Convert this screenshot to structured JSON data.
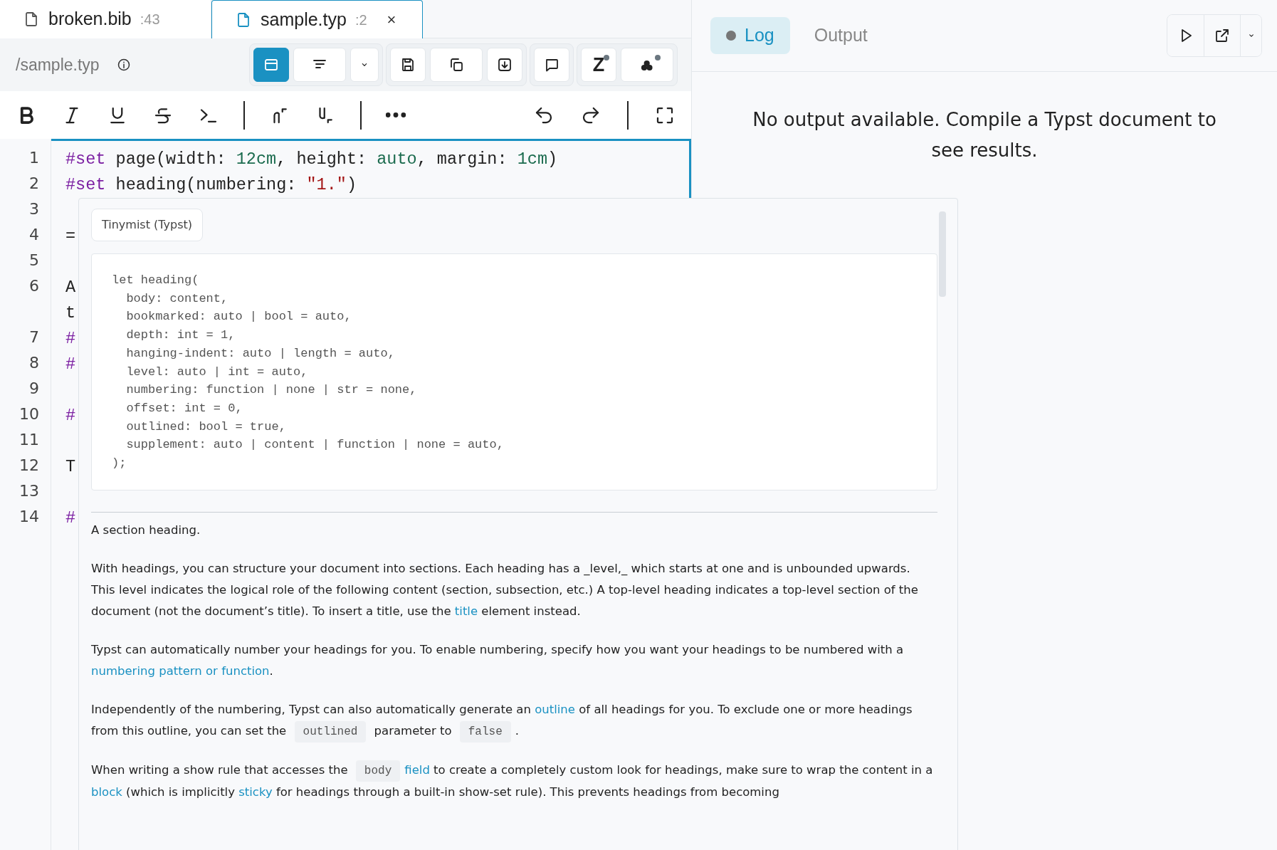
{
  "file_tabs": [
    {
      "label": "broken.bib",
      "badge": ":43",
      "selected": false
    },
    {
      "label": "sample.typ",
      "badge": ":2",
      "selected": true,
      "close": "×"
    }
  ],
  "path": "/sample.typ",
  "toolbar": {
    "groups": [
      [
        {
          "kind": "panel",
          "pressed": true
        },
        {
          "kind": "align",
          "pressed": false
        },
        {
          "kind": "dropdown",
          "pressed": false
        }
      ],
      [
        {
          "kind": "save",
          "pressed": false
        },
        {
          "kind": "copy",
          "pressed": false
        },
        {
          "kind": "download",
          "pressed": false
        }
      ],
      [
        {
          "kind": "comment",
          "pressed": false
        }
      ],
      [
        {
          "kind": "letter",
          "label": "Z",
          "pressed": false
        },
        {
          "kind": "cluster",
          "pressed": false
        }
      ]
    ]
  },
  "format_bar": {
    "left": [
      {
        "kind": "bold"
      },
      {
        "kind": "italic"
      },
      {
        "kind": "underline"
      },
      {
        "kind": "strike"
      },
      {
        "kind": "code"
      },
      {
        "kind": "separator"
      },
      {
        "kind": "superscript"
      },
      {
        "kind": "subscript"
      },
      {
        "kind": "separator"
      },
      {
        "kind": "more"
      }
    ],
    "right": [
      {
        "kind": "undo"
      },
      {
        "kind": "redo"
      },
      {
        "kind": "separator"
      },
      {
        "kind": "fullscreen"
      }
    ]
  },
  "editor": {
    "rows": [
      {
        "number": "1",
        "tokens": [
          {
            "text": "#set",
            "kind": "keyword"
          },
          {
            "text": " page(width: ",
            "kind": "plain"
          },
          {
            "text": "12cm",
            "kind": "value"
          },
          {
            "text": ", height: ",
            "kind": "plain"
          },
          {
            "text": "auto",
            "kind": "value"
          },
          {
            "text": ", margin: ",
            "kind": "plain"
          },
          {
            "text": "1cm",
            "kind": "value"
          },
          {
            "text": ")",
            "kind": "plain"
          }
        ]
      },
      {
        "number": "2",
        "tokens": [
          {
            "text": "#set",
            "kind": "keyword"
          },
          {
            "text": " heading(numbering: ",
            "kind": "plain"
          },
          {
            "text": "\"1.\"",
            "kind": "string"
          },
          {
            "text": ")",
            "kind": "plain"
          }
        ]
      },
      {
        "number": "3",
        "tokens": []
      },
      {
        "number": "4",
        "tokens": [
          {
            "text": "=",
            "kind": "plain"
          }
        ]
      },
      {
        "number": "5",
        "tokens": []
      },
      {
        "number": "6",
        "tokens": [
          {
            "text": "A",
            "kind": "plain"
          }
        ]
      },
      {
        "tokens": [
          {
            "text": "t",
            "kind": "plain"
          }
        ]
      },
      {
        "number": "7",
        "tokens": [
          {
            "text": "#",
            "kind": "keyword"
          }
        ]
      },
      {
        "number": "8",
        "tokens": [
          {
            "text": "#",
            "kind": "keyword"
          }
        ]
      },
      {
        "number": "9",
        "tokens": []
      },
      {
        "number": "10",
        "tokens": [
          {
            "text": "#",
            "kind": "keyword"
          }
        ]
      },
      {
        "number": "11",
        "tokens": []
      },
      {
        "number": "12",
        "tokens": [
          {
            "text": "T",
            "kind": "plain"
          }
        ]
      },
      {
        "number": "13",
        "tokens": []
      },
      {
        "number": "14",
        "tokens": [
          {
            "text": "#",
            "kind": "keyword"
          }
        ]
      }
    ]
  },
  "hover": {
    "source": "Tinymist (Typst)",
    "signature": [
      "let heading(",
      "  body: content,",
      "  bookmarked: auto | bool = auto,",
      "  depth: int = 1,",
      "  hanging-indent: auto | length = auto,",
      "  level: auto | int = auto,",
      "  numbering: function | none | str = none,",
      "  offset: int = 0,",
      "  outlined: bool = true,",
      "  supplement: auto | content | function | none = auto,",
      ");"
    ],
    "paragraphs": [
      [
        {
          "kind": "text",
          "text": "A section heading."
        }
      ],
      [
        {
          "kind": "text",
          "text": "With headings, you can structure your document into sections. Each heading has a _level,_ which starts at one and is unbounded upwards. This level indicates the logical role of the following content (section, subsection, etc.) A top-level heading indicates a top-level section of the document (not the document’s title). To insert a title, use the "
        },
        {
          "kind": "link",
          "text": "title"
        },
        {
          "kind": "text",
          "text": " element instead."
        }
      ],
      [
        {
          "kind": "text",
          "text": "Typst can automatically number your headings for you. To enable numbering, specify how you want your headings to be numbered with a "
        },
        {
          "kind": "link",
          "text": "numbering pattern or function"
        },
        {
          "kind": "text",
          "text": "."
        }
      ],
      [
        {
          "kind": "text",
          "text": "Independently of the numbering, Typst can also automatically generate an "
        },
        {
          "kind": "link",
          "text": "outline"
        },
        {
          "kind": "text",
          "text": " of all headings for you. To exclude one or more headings from this outline, you can set the "
        },
        {
          "kind": "code",
          "text": "outlined"
        },
        {
          "kind": "text",
          "text": " parameter to "
        },
        {
          "kind": "code",
          "text": "false"
        },
        {
          "kind": "text",
          "text": "."
        }
      ],
      [
        {
          "kind": "text",
          "text": "When writing a show rule that accesses the "
        },
        {
          "kind": "code",
          "text": "body"
        },
        {
          "kind": "link",
          "text": "field"
        },
        {
          "kind": "text",
          "text": " to create a completely custom look for headings, make sure to wrap the content in a "
        },
        {
          "kind": "link",
          "text": "block"
        },
        {
          "kind": "text",
          "text": " (which is implicitly "
        },
        {
          "kind": "link",
          "text": "sticky"
        },
        {
          "kind": "text",
          "text": " for headings through a built-in show-set rule). This prevents headings from becoming"
        }
      ]
    ]
  },
  "output_panel": {
    "tabs": [
      {
        "label": "Log",
        "selected": true,
        "indicator": true
      },
      {
        "label": "Output",
        "selected": false,
        "indicator": false
      }
    ],
    "actions": [
      {
        "kind": "run"
      },
      {
        "kind": "open-external"
      },
      {
        "kind": "dropdown"
      }
    ],
    "message": "No output available. Compile a Typst document to see results."
  }
}
